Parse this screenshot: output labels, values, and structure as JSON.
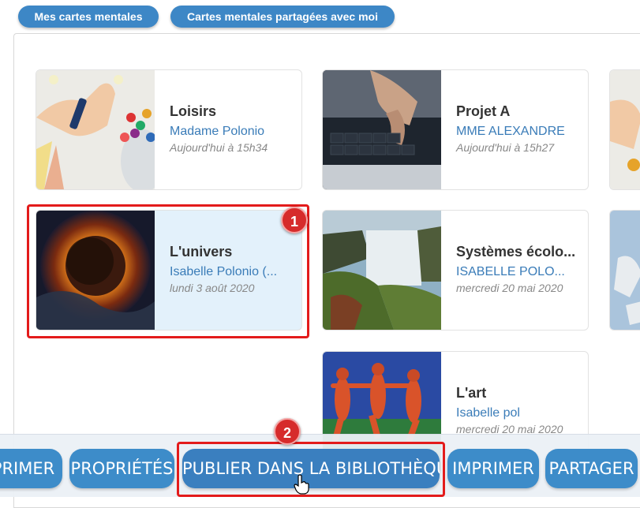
{
  "tabs": {
    "my_maps": "Mes cartes mentales",
    "shared_maps": "Cartes mentales partagées avec moi"
  },
  "cards": [
    {
      "title": "Loisirs",
      "owner": "Madame Polonio",
      "date": "Aujourd'hui à 15h34",
      "thumb": "crayons-image"
    },
    {
      "title": "Projet A",
      "owner": "MME ALEXANDRE",
      "date": "Aujourd'hui à 15h27",
      "thumb": "laptop-image"
    },
    {
      "title": "L'univers",
      "owner": "Isabelle Polonio (...",
      "date": "lundi 3 août 2020",
      "thumb": "eclipse-image",
      "selected": true
    },
    {
      "title": "Systèmes écolo...",
      "owner": "ISABELLE POLO...",
      "date": "mercredi 20 mai 2020",
      "thumb": "waterfall-image"
    },
    {
      "title": "L'art",
      "owner": "Isabelle pol",
      "date": "mercredi 20 mai 2020",
      "thumb": "dance-painting-image"
    }
  ],
  "annotations": {
    "step1": "1",
    "step2": "2"
  },
  "toolbar": {
    "print_partial": "PRIMER",
    "properties": "PROPRIÉTÉS",
    "publish": "PUBLIER DANS LA BIBLIOTHÈQUE",
    "print": "IMPRIMER",
    "share": "PARTAGER"
  },
  "colors": {
    "accent": "#3d8cc9",
    "highlight": "#e31b1b",
    "selected_bg": "#e3f1fb"
  }
}
